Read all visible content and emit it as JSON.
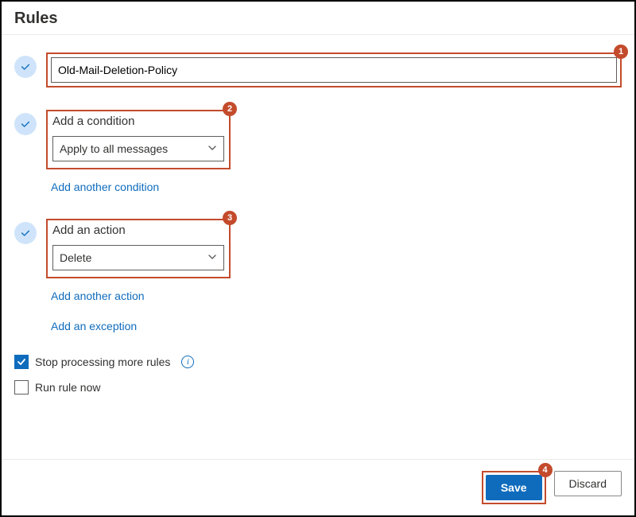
{
  "header": {
    "title": "Rules"
  },
  "ruleName": {
    "value": "Old-Mail-Deletion-Policy"
  },
  "condition": {
    "label": "Add a condition",
    "selected": "Apply to all messages",
    "addAnother": "Add another condition"
  },
  "action": {
    "label": "Add an action",
    "selected": "Delete",
    "addAnother": "Add another action"
  },
  "exception": {
    "add": "Add an exception"
  },
  "options": {
    "stopProcessing": {
      "label": "Stop processing more rules",
      "checked": true
    },
    "runNow": {
      "label": "Run rule now",
      "checked": false
    }
  },
  "footer": {
    "save": "Save",
    "discard": "Discard"
  },
  "callouts": {
    "c1": "1",
    "c2": "2",
    "c3": "3",
    "c4": "4"
  }
}
